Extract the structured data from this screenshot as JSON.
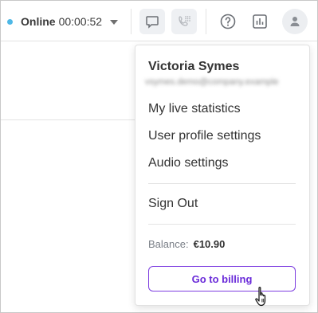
{
  "header": {
    "status_label": "Online",
    "status_timer": "00:00:52",
    "status_color": "#4fb8e6",
    "icons": [
      "chat-icon",
      "phone-dialpad-icon",
      "help-icon",
      "statistics-icon",
      "user-avatar-icon"
    ]
  },
  "menu": {
    "user_name": "Victoria Symes",
    "user_email": "vsymes.demo@company.example",
    "items": {
      "live_statistics": "My live statistics",
      "profile_settings": "User profile settings",
      "audio_settings": "Audio settings",
      "sign_out": "Sign Out"
    },
    "balance_label": "Balance:",
    "balance_value": "€10.90",
    "billing_button": "Go to billing"
  },
  "colors": {
    "accent": "#6a2bd9",
    "accent_border": "#7d3ee0"
  }
}
